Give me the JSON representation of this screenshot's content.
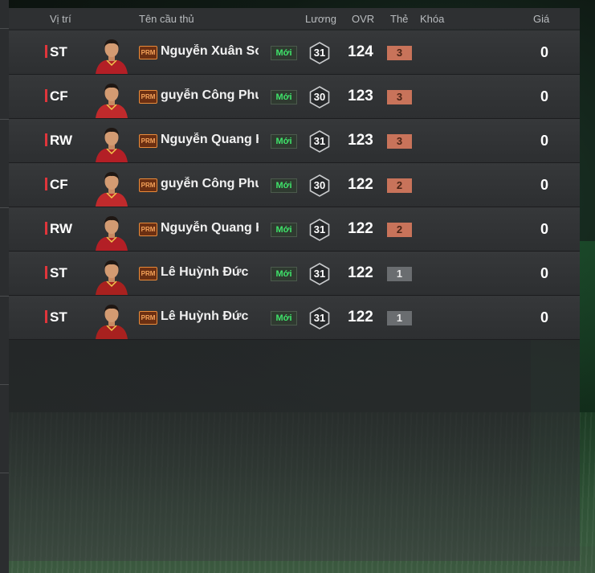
{
  "header": {
    "col_position": "Vị trí",
    "col_name": "Tên cầu thủ",
    "col_salary": "Lương",
    "col_ovr": "OVR",
    "col_card": "Thẻ",
    "col_lock": "Khóa",
    "col_price": "Giá"
  },
  "badges": {
    "prm": "PRM",
    "new": "Mới"
  },
  "colors": {
    "position_bar": "#e0353b",
    "new_text": "#3fe36a",
    "card_bronze": "#c8735a",
    "card_grey": "#6a6d70"
  },
  "players": [
    {
      "position": "ST",
      "name": "Nguyễn Xuân Son",
      "salary": "31",
      "ovr": "124",
      "card_level": "3",
      "card_tier": "bronze",
      "lock": "",
      "price": "0"
    },
    {
      "position": "CF",
      "name": "guyễn Công Phượ",
      "salary": "30",
      "ovr": "123",
      "card_level": "3",
      "card_tier": "bronze",
      "lock": "",
      "price": "0"
    },
    {
      "position": "RW",
      "name": "Nguyễn Quang Hả",
      "salary": "31",
      "ovr": "123",
      "card_level": "3",
      "card_tier": "bronze",
      "lock": "",
      "price": "0"
    },
    {
      "position": "CF",
      "name": "guyễn Công Phượ",
      "salary": "30",
      "ovr": "122",
      "card_level": "2",
      "card_tier": "bronze",
      "lock": "",
      "price": "0"
    },
    {
      "position": "RW",
      "name": "Nguyễn Quang Hả",
      "salary": "31",
      "ovr": "122",
      "card_level": "2",
      "card_tier": "bronze",
      "lock": "",
      "price": "0"
    },
    {
      "position": "ST",
      "name": "Lê Huỳnh Đức",
      "salary": "31",
      "ovr": "122",
      "card_level": "1",
      "card_tier": "grey",
      "lock": "",
      "price": "0"
    },
    {
      "position": "ST",
      "name": "Lê Huỳnh Đức",
      "salary": "31",
      "ovr": "122",
      "card_level": "1",
      "card_tier": "grey",
      "lock": "",
      "price": "0"
    }
  ]
}
